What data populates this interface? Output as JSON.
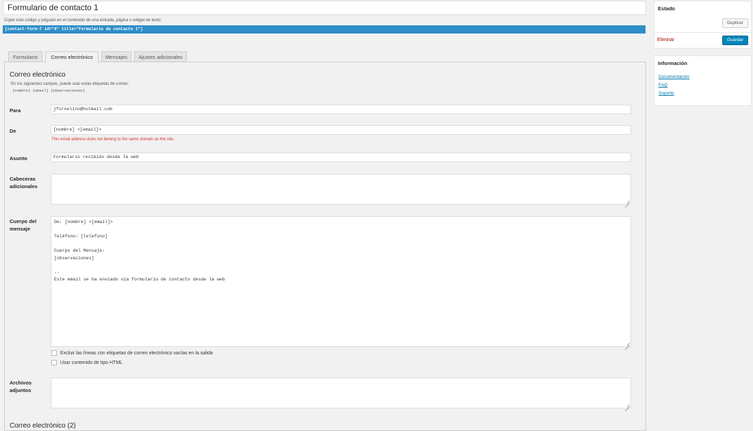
{
  "form": {
    "title": "Formulario de contacto 1",
    "shortcode_hint": "Copie este código y péguelo en el contenido de una entrada, página o widget de texto:",
    "shortcode": "[contact-form-7 id=\"4\" title=\"Formulario de contacto 1\"]"
  },
  "tabs": [
    {
      "label": "Formulario"
    },
    {
      "label": "Correo electrónico",
      "active": true
    },
    {
      "label": "Mensajes"
    },
    {
      "label": "Ajustes adicionales"
    }
  ],
  "mail": {
    "section_title": "Correo electrónico",
    "tags_intro": "En los siguientes campos, puede usar estas etiquetas de correo:",
    "tags": "[nombre] [email] [observaciones]",
    "to_label": "Para",
    "to_value": "jfornelino@hotmail.com",
    "from_label": "De",
    "from_value": "[nombre] <[email]>",
    "from_error": "This email address does not belong to the same domain as the site.",
    "subject_label": "Asunto",
    "subject_value": "Formulario recibido desde la web",
    "headers_label": "Cabeceras adicionales",
    "headers_value": "",
    "body_label": "Cuerpo del mensaje",
    "body_lines": [
      "De: [nombre] <[email]>",
      "",
      "Teléfono: [telefono]",
      "",
      "Cuerpo del Mensaje:",
      "[observaciones]",
      "",
      "--",
      "Este email se ha enviado vía formulario de contacto desde la web"
    ],
    "exclude_blank_label": "Excluir las líneas con etiquetas de correo electrónico vacías en la salida",
    "use_html_label": "Usar contenido de tipo HTML",
    "attachments_label": "Archivos adjuntos",
    "attachments_value": "",
    "mail2_title": "Correo electrónico (2)"
  },
  "sidebar": {
    "status_title": "Estado",
    "duplicate_label": "Duplicar",
    "delete_label": "Eliminar",
    "save_label": "Guardar",
    "info_title": "Información",
    "links": [
      "Documentación",
      "FAQ",
      "Soporte"
    ]
  },
  "colors": {
    "shortcode_bg": "#2e8ec8",
    "primary_button": "#0085ba",
    "error_text": "#dc3232",
    "link": "#0073aa"
  }
}
